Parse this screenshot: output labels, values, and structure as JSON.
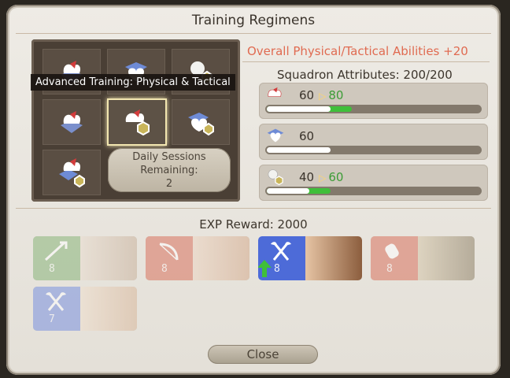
{
  "window": {
    "title": "Training Regimens"
  },
  "grid": {
    "tooltip": "Advanced Training: Physical & Tactical",
    "daily": {
      "line1": "Daily Sessions",
      "line2": "Remaining:",
      "count": "2"
    }
  },
  "attributes": {
    "overall": "Overall Physical/Tactical Abilities +20",
    "title": "Squadron Attributes: 200/200",
    "rows": [
      {
        "icon": "physical-icon",
        "value": "60",
        "new_value": "80",
        "fraction": 0.3,
        "new_fraction": 0.4
      },
      {
        "icon": "mental-icon",
        "value": "60",
        "new_value": "",
        "fraction": 0.3,
        "new_fraction": 0.3
      },
      {
        "icon": "tactical-icon",
        "value": "40",
        "new_value": "60",
        "fraction": 0.2,
        "new_fraction": 0.3
      }
    ]
  },
  "exp": {
    "label": "EXP Reward: 2000"
  },
  "members": [
    {
      "level": "8",
      "job": "lancer",
      "color": "#8ab57a",
      "portrait": "#d9c9b6"
    },
    {
      "level": "8",
      "job": "archer",
      "color": "#d9735f",
      "portrait": "#e4c7b4"
    },
    {
      "level": "8",
      "job": "marauder",
      "color": "#4d6bd8",
      "portrait": "#c0906f"
    },
    {
      "level": "8",
      "job": "pugilist",
      "color": "#d9735f",
      "portrait": "#b8a88a"
    },
    {
      "level": "7",
      "job": "marauder",
      "color": "#7a92e0",
      "portrait": "#e7cfb8"
    }
  ],
  "close": "Close",
  "colors": {
    "accent_red": "#e06b51",
    "gain_green": "#3c9c36",
    "bar_green": "#3fbf3a"
  }
}
